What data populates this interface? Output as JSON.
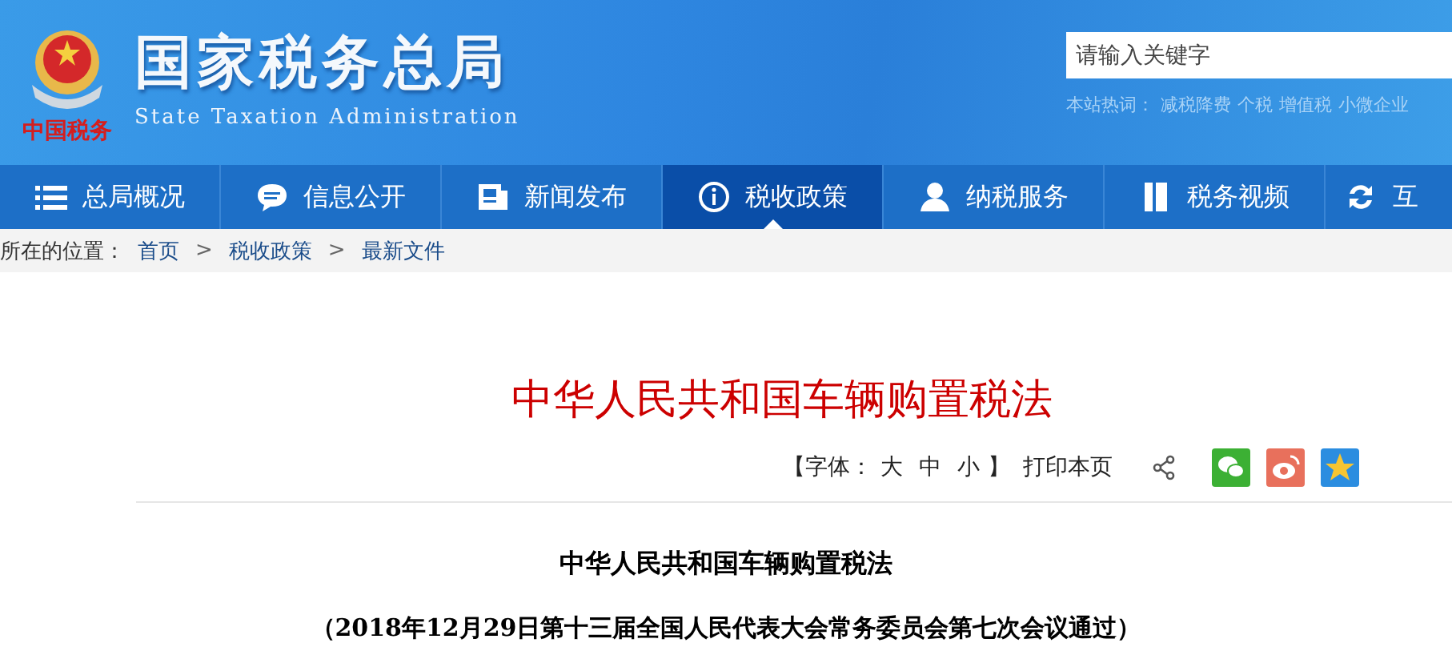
{
  "header": {
    "seal_text": "中国税务",
    "title": "国家税务总局",
    "subtitle": "State Taxation Administration",
    "search": {
      "placeholder": "请输入关键字"
    },
    "hot_label": "本站热词：",
    "hot_words": [
      "减税降费",
      "个税",
      "增值税",
      "小微企业"
    ]
  },
  "nav": [
    {
      "label": "总局概况",
      "selected": false
    },
    {
      "label": "信息公开",
      "selected": false
    },
    {
      "label": "新闻发布",
      "selected": false
    },
    {
      "label": "税收政策",
      "selected": true
    },
    {
      "label": "纳税服务",
      "selected": false
    },
    {
      "label": "税务视频",
      "selected": false
    },
    {
      "label": "互",
      "selected": false
    }
  ],
  "breadcrumb": {
    "label": "所在的位置：",
    "items": [
      "首页",
      "税收政策",
      "最新文件"
    ],
    "separator": ">"
  },
  "article": {
    "title": "中华人民共和国车辆购置税法",
    "font_open": "【字体：",
    "font_sizes": [
      "大",
      "中",
      "小"
    ],
    "font_close": "】",
    "print": "打印本页",
    "heading": "中华人民共和国车辆购置税法",
    "subheading": "（2018年12月29日第十三届全国人民代表大会常务委员会第七次会议通过）"
  }
}
